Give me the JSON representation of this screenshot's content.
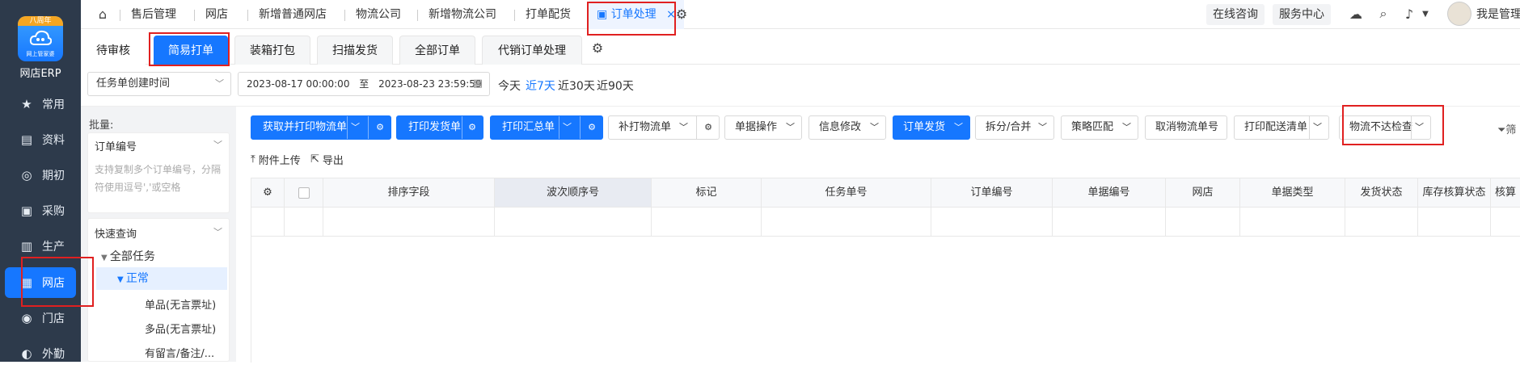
{
  "sidebar": {
    "logo_top": "八周年",
    "logo_sub": "网上管家婆",
    "brand": "网店ERP",
    "items": [
      {
        "label": "常用",
        "icon": "star-icon"
      },
      {
        "label": "资料",
        "icon": "document-icon"
      },
      {
        "label": "期初",
        "icon": "target-icon"
      },
      {
        "label": "采购",
        "icon": "cart-icon"
      },
      {
        "label": "生产",
        "icon": "factory-icon"
      },
      {
        "label": "网店",
        "icon": "shop-icon"
      },
      {
        "label": "门店",
        "icon": "location-icon"
      },
      {
        "label": "外勤",
        "icon": "field-icon"
      }
    ]
  },
  "topbar": {
    "tabs": [
      "售后管理",
      "网店",
      "新增普通网店",
      "物流公司",
      "新增物流公司",
      "打单配货",
      "订单处理"
    ],
    "active_close": "×",
    "right": {
      "consult": "在线咨询",
      "service": "服务中心",
      "user": "我是管理"
    }
  },
  "subtabs": [
    "待审核",
    "简易打单",
    "装箱打包",
    "扫描发货",
    "全部订单",
    "代销订单处理"
  ],
  "filter": {
    "time_type": "任务单创建时间",
    "start": "2023-08-17 00:00:00",
    "to": "至",
    "end": "2023-08-23 23:59:59",
    "quick": [
      "今天",
      "近7天",
      "近30天",
      "近90天"
    ]
  },
  "left": {
    "batch_label": "批量:",
    "order_no": "订单编号",
    "placeholder": "支持复制多个订单编号，分隔符使用逗号','或空格",
    "quick_query": "快速查询",
    "tree": [
      "全部任务",
      "正常",
      "单品(无言票址)",
      "多品(无言票址)",
      "有留言/备注/..."
    ]
  },
  "toolbar": {
    "buttons": [
      "获取并打印物流单",
      "打印发货单",
      "打印汇总单",
      "补打物流单",
      "单据操作",
      "信息修改",
      "订单发货",
      "拆分/合并",
      "策略匹配",
      "取消物流单号",
      "打印配送清单",
      "物流不达检查"
    ],
    "filter_label": "筛",
    "upload": "附件上传",
    "export": "导出"
  },
  "table": {
    "columns": [
      "排序字段",
      "波次顺序号",
      "标记",
      "任务单号",
      "订单编号",
      "单据编号",
      "网店",
      "单据类型",
      "发货状态",
      "库存核算状态",
      "核算"
    ]
  }
}
